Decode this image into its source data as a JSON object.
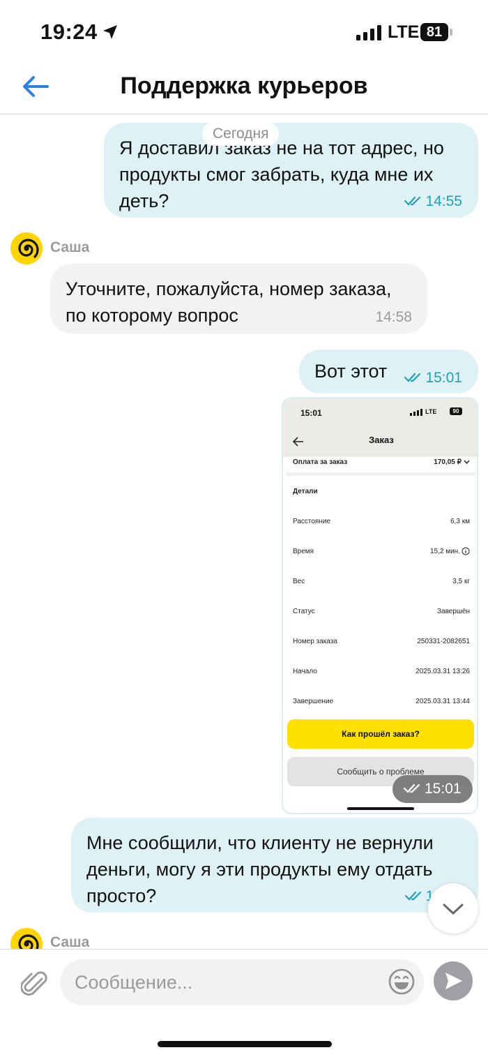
{
  "status_bar": {
    "time": "19:24",
    "network": "LTE",
    "battery": "81"
  },
  "header": {
    "title": "Поддержка курьеров"
  },
  "chat": {
    "date_label": "Сегодня",
    "messages": [
      {
        "side": "out",
        "text": "Я доставил заказ не на тот адрес, но продукты смог забрать, куда мне их деть?",
        "line1": "Я доставил заказ не на тот адрес, но",
        "line2": "продукты смог забрать, куда мне их",
        "line3": "деть?",
        "time": "14:55"
      },
      {
        "side": "in",
        "sender": "Саша",
        "line1": "Уточните, пожалуйста, номер заказа,",
        "line2": "по которому вопрос",
        "time": "14:58"
      },
      {
        "side": "out",
        "text": "Вот этот",
        "time": "15:01"
      },
      {
        "side": "out",
        "type": "image",
        "time": "15:01"
      },
      {
        "side": "out",
        "line1": "Мне сообщили, что клиенту не вернули",
        "line2": "деньги, могу я эти продукты ему отдать",
        "line3": "просто?",
        "time": "15"
      }
    ],
    "last_sender": "Саша"
  },
  "screenshot": {
    "time": "15:01",
    "network": "LTE",
    "battery": "90",
    "title": "Заказ",
    "payment_label": "Оплата за заказ",
    "payment_value": "170,05 ₽",
    "details_title": "Детали",
    "rows": [
      {
        "label": "Расстояние",
        "value": "6,3 км"
      },
      {
        "label": "Время",
        "value": "15,2 мин."
      },
      {
        "label": "Вес",
        "value": "3,5 кг"
      },
      {
        "label": "Статус",
        "value": "Завершён"
      },
      {
        "label": "Номер заказа",
        "value": "250331-2082651"
      },
      {
        "label": "Начало",
        "value": "2025.03.31 13:26"
      },
      {
        "label": "Завершение",
        "value": "2025.03.31 13:44"
      }
    ],
    "primary_button": "Как прошёл заказ?",
    "secondary_button": "Сообщить о проблеме"
  },
  "composer": {
    "placeholder": "Сообщение..."
  },
  "colors": {
    "accent": "#1fa0b7",
    "outgoing": "#def1f4",
    "incoming": "#f2f2f2",
    "yellow": "#fbe000",
    "back_arrow": "#2a82e4"
  }
}
